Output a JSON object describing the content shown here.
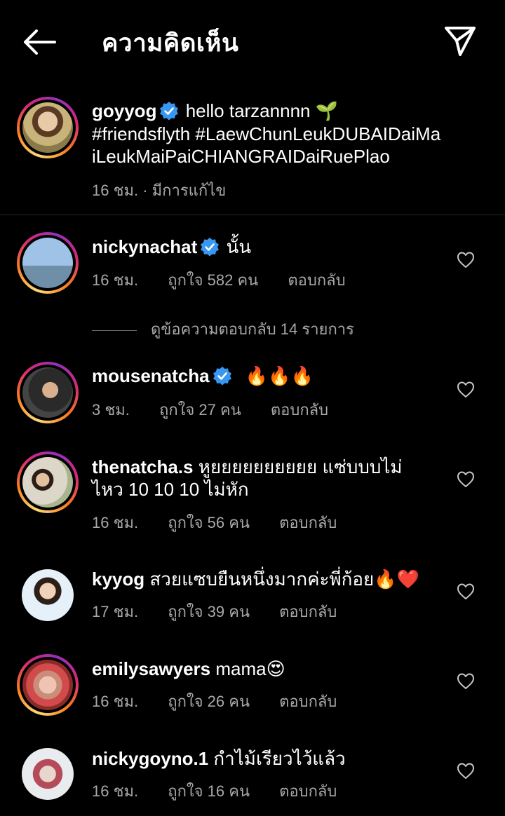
{
  "header": {
    "title": "ความคิดเห็น",
    "back_icon": "arrow-left-icon",
    "send_icon": "paper-plane-icon"
  },
  "caption": {
    "username": "goyyog",
    "text": "hello tarzannnn",
    "emoji": "🌱",
    "hashtags": "#friendsflyth #LaewChunLeukDUBAIDaiMa iLeukMaiPaiCHIANGRAIDaiRuePlao",
    "meta": "16 ชม. · มีการแก้ไข"
  },
  "comments": [
    {
      "username": "nickynachat",
      "verified": true,
      "text": "นั้น",
      "time": "16 ชม.",
      "likes": "ถูกใจ 582 คน",
      "reply": "ตอบกลับ",
      "view_replies": "ดูข้อความตอบกลับ 14 รายการ"
    },
    {
      "username": "mousenatcha",
      "verified": true,
      "text": "🔥🔥🔥",
      "time": "3 ชม.",
      "likes": "ถูกใจ 27 คน",
      "reply": "ตอบกลับ"
    },
    {
      "username": "thenatcha.s",
      "verified": false,
      "text_line1": "หูยยยยยยยยยย แซ่บบบไม่",
      "text_line2": "ไหว 10 10 10 ไม่หัก",
      "time": "16 ชม.",
      "likes": "ถูกใจ 56 คน",
      "reply": "ตอบกลับ"
    },
    {
      "username": "kyyog",
      "verified": false,
      "text": "สวยแซบยืนหนึ่งมากค่ะพี่ก้อย",
      "emoji": "🔥❤️",
      "time": "17 ชม.",
      "likes": "ถูกใจ 39 คน",
      "reply": "ตอบกลับ"
    },
    {
      "username": "emilysawyers",
      "verified": false,
      "text": "mama",
      "emoji": "😍",
      "time": "16 ชม.",
      "likes": "ถูกใจ 26 คน",
      "reply": "ตอบกลับ"
    },
    {
      "username": "nickygoyno.1",
      "verified": false,
      "text": "กำไม้เรียวไว้แล้ว",
      "time": "16 ชม.",
      "likes": "ถูกใจ 16 คน",
      "reply": "ตอบกลับ"
    }
  ],
  "colors": {
    "background": "#000000",
    "secondary_text": "#a8a8a8",
    "verified": "#3897f0",
    "divider": "#262626"
  }
}
